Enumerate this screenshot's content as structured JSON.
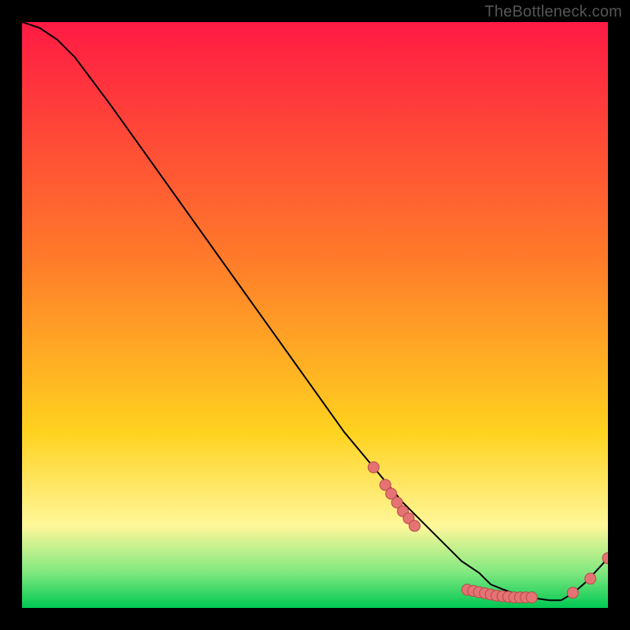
{
  "watermark": "TheBottleneck.com",
  "colors": {
    "bg": "#000000",
    "gradient_top": "#ff1a44",
    "gradient_mid1": "#ff7a2a",
    "gradient_mid2": "#ffd21f",
    "gradient_band_light": "#fff79a",
    "gradient_band_green_light": "#7fe87f",
    "gradient_bottom": "#00c853",
    "curve": "#000000",
    "marker_fill": "#e57373",
    "marker_stroke": "#b84a4a"
  },
  "chart_data": {
    "type": "line",
    "title": "",
    "xlabel": "",
    "ylabel": "",
    "xlim": [
      0,
      100
    ],
    "ylim": [
      0,
      100
    ],
    "curve": {
      "x": [
        0,
        3,
        6,
        9,
        12,
        15,
        20,
        25,
        30,
        35,
        40,
        45,
        50,
        55,
        60,
        65,
        70,
        73,
        75,
        78,
        80,
        82,
        84,
        86,
        88,
        90,
        92,
        94,
        96,
        98,
        100
      ],
      "y": [
        100,
        99,
        97,
        94,
        90,
        86,
        79,
        72,
        65,
        58,
        51,
        44,
        37,
        30,
        24,
        18,
        13,
        10,
        8,
        6,
        4,
        3.2,
        2.5,
        2,
        1.6,
        1.3,
        1.3,
        2.5,
        4.2,
        6.3,
        8.5
      ]
    },
    "markers": [
      {
        "x": 60,
        "y": 24
      },
      {
        "x": 62,
        "y": 21
      },
      {
        "x": 63,
        "y": 19.5
      },
      {
        "x": 64,
        "y": 18
      },
      {
        "x": 65,
        "y": 16.5
      },
      {
        "x": 66,
        "y": 15.3
      },
      {
        "x": 67,
        "y": 14
      },
      {
        "x": 76,
        "y": 3.1
      },
      {
        "x": 77,
        "y": 2.9
      },
      {
        "x": 78,
        "y": 2.7
      },
      {
        "x": 79,
        "y": 2.5
      },
      {
        "x": 80,
        "y": 2.3
      },
      {
        "x": 81,
        "y": 2.1
      },
      {
        "x": 82,
        "y": 2.0
      },
      {
        "x": 83,
        "y": 1.9
      },
      {
        "x": 84,
        "y": 1.8
      },
      {
        "x": 85,
        "y": 1.8
      },
      {
        "x": 86,
        "y": 1.8
      },
      {
        "x": 87,
        "y": 1.8
      },
      {
        "x": 94,
        "y": 2.6
      },
      {
        "x": 97,
        "y": 5.0
      },
      {
        "x": 100,
        "y": 8.5
      }
    ]
  }
}
